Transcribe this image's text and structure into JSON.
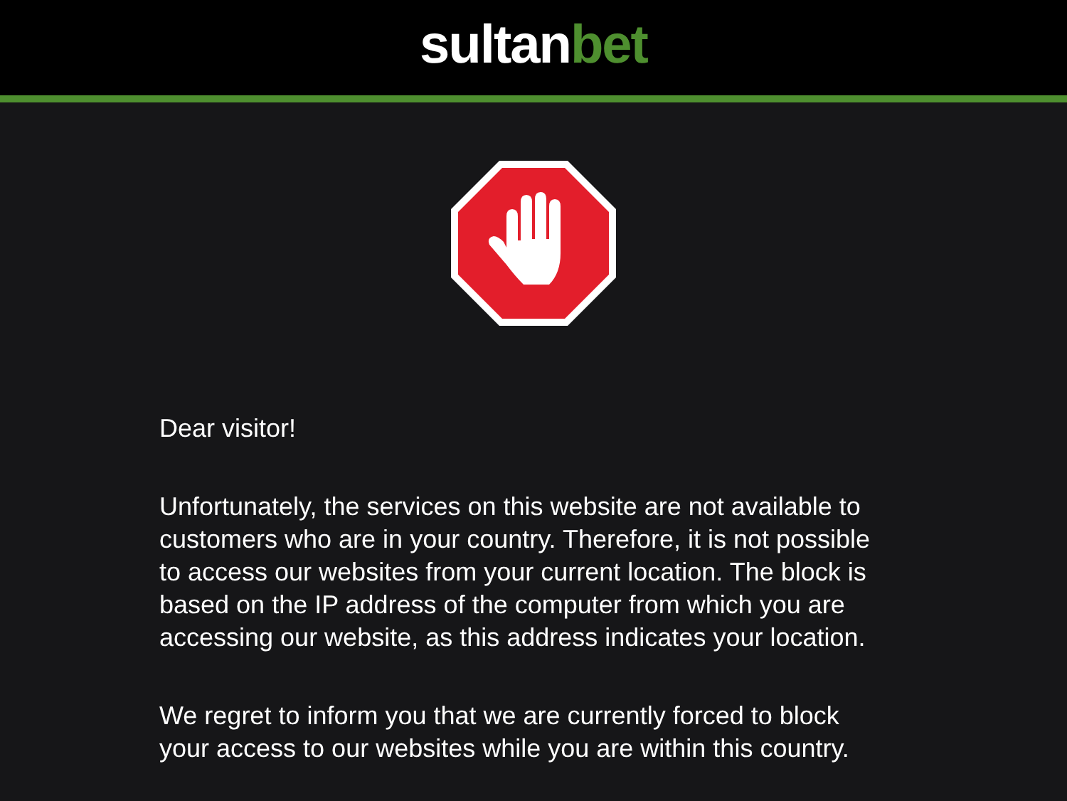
{
  "header": {
    "logo": [
      {
        "text": "sultan",
        "color": "#ffffff"
      },
      {
        "text": "bet",
        "color": "#4e8f2f"
      }
    ]
  },
  "message": {
    "greeting": "Dear visitor!",
    "paragraphs": [
      "Unfortunately, the services on this website are not available to customers who are in your country. Therefore, it is not possible to access our websites from your current location. The block is based on the IP address of the computer from which you are accessing our website, as this address indicates your location.",
      "We regret to inform you that we are currently forced to block your access to our websites while you are within this country."
    ]
  }
}
